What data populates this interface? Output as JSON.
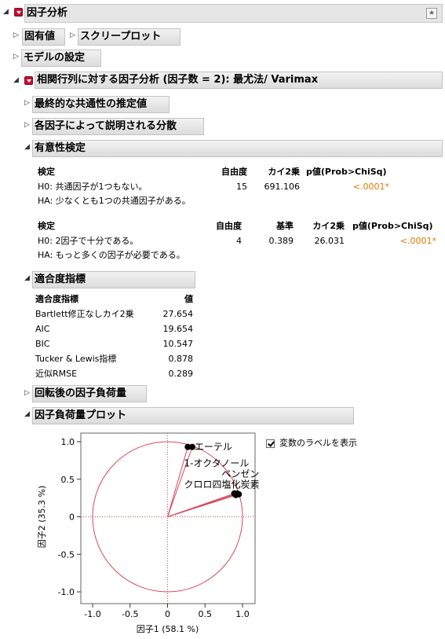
{
  "report": {
    "title": "因子分析",
    "eigenvalues_label": "固有値",
    "scree_plot_label": "スクリープロット",
    "model_settings_label": "モデルの設定",
    "analysis_title": "相関行列に対する因子分析 (因子数 = 2): 最尤法/ Varimax"
  },
  "sections": {
    "communality": "最終的な共通性の推定値",
    "variance_explained": "各因子によって説明される分散",
    "significance": "有意性検定",
    "fit": "適合度指標",
    "rotated_loadings": "回転後の因子負荷量",
    "loading_plot": "因子負荷量プロット"
  },
  "sig_test1": {
    "headers": {
      "test": "検定",
      "df": "自由度",
      "chisq": "カイ2乗",
      "p": "p値(Prob>ChiSq)"
    },
    "h0": "H0: 共通因子が1つもない。",
    "ha": "HA: 少なくとも1つの共通因子がある。",
    "df": "15",
    "chisq": "691.106",
    "p": "<.0001*"
  },
  "sig_test2": {
    "headers": {
      "test": "検定",
      "df": "自由度",
      "criterion": "基準",
      "chisq": "カイ2乗",
      "p": "p値(Prob>ChiSq)"
    },
    "h0": "H0: 2因子で十分である。",
    "ha": "HA: もっと多くの因子が必要である。",
    "df": "4",
    "criterion": "0.389",
    "chisq": "26.031",
    "p": "<.0001*"
  },
  "fit_table": {
    "headers": {
      "name": "適合度指標",
      "value": "値"
    },
    "rows": [
      {
        "name": "Bartlett修正なしカイ2乗",
        "value": "27.654"
      },
      {
        "name": "AIC",
        "value": "19.654"
      },
      {
        "name": "BIC",
        "value": "10.547"
      },
      {
        "name": "Tucker & Lewis指標",
        "value": "0.878"
      },
      {
        "name": "近似RMSE",
        "value": "0.289"
      }
    ]
  },
  "plot_options": {
    "show_labels": "変数のラベルを表示",
    "show_labels_checked": true
  },
  "chart_data": {
    "type": "scatter",
    "xlabel": "因子1 (58.1 %)",
    "ylabel": "因子2 (35.3 %)",
    "xlim": [
      -1.2,
      1.1
    ],
    "ylim": [
      -1.1,
      1.1
    ],
    "x_ticks": [
      "-1.0",
      "-0.5",
      "0",
      "0.5",
      "1.0"
    ],
    "y_ticks": [
      "1.0",
      "0.5",
      "0",
      "-0.5",
      "-1.0"
    ],
    "unit_circle": true,
    "reference_lines": "x=0, y=0 (dotted)",
    "series": [
      {
        "points": [
          {
            "label": "エーテル",
            "x": 0.33,
            "y": 0.93
          },
          {
            "label": "1-オクタノール",
            "x": 0.27,
            "y": 0.93
          },
          {
            "label": "ベンゼン",
            "x": 0.93,
            "y": 0.31
          },
          {
            "label": "クロロホルム",
            "x": 0.89,
            "y": 0.31
          },
          {
            "label": "四塩化炭素",
            "x": 0.95,
            "y": 0.3
          },
          {
            "label": "炭素",
            "x": 0.91,
            "y": 0.29
          }
        ]
      }
    ],
    "label_text": [
      "エーテル",
      "1-オクタノール",
      "ベンゼン",
      "クロロ四塩化炭素"
    ]
  }
}
